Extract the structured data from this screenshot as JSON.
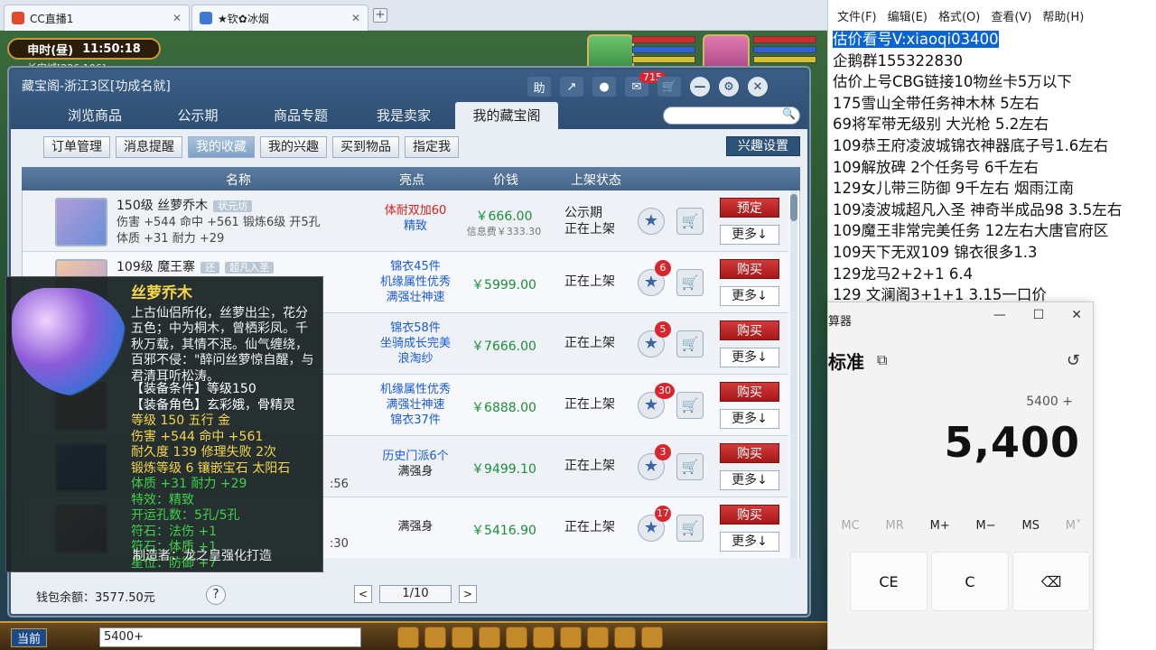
{
  "browser": {
    "tabs": [
      {
        "label": "CC直播1"
      },
      {
        "label": "★钦✿冰烟"
      }
    ],
    "new_tab": "+"
  },
  "game": {
    "time_label": "申时(昼)",
    "time_value": "11:50:18",
    "map": "长安城[226,106]",
    "chat_channel": "当前",
    "chat_input": "5400+"
  },
  "cbg": {
    "title": "藏宝阁-浙江3区[功成名就]",
    "ctrl": {
      "help": "助",
      "notif_count": "715"
    },
    "nav_tabs": [
      "浏览商品",
      "公示期",
      "商品专题",
      "我是卖家",
      "我的藏宝阁"
    ],
    "active_nav": 4,
    "sub_tabs": [
      "订单管理",
      "消息提醒",
      "我的收藏",
      "我的兴趣",
      "买到物品",
      "指定我"
    ],
    "active_sub": 2,
    "interest_button": "兴趣设置",
    "columns": {
      "name": "名称",
      "highlight": "亮点",
      "price": "价钱",
      "status": "上架状态"
    },
    "rows": [
      {
        "name": "150级  丝萝乔木",
        "tag": "状元坊",
        "line2": "伤害 +544 命中 +561 锻炼6级 开5孔",
        "line3": "体质 +31 耐力 +29",
        "hl": [
          "体耐双加60",
          "精致"
        ],
        "hl_red": true,
        "price": "￥666.00",
        "fee": "信息费￥333.30",
        "status1": "公示期",
        "status2": "正在上架",
        "badge": "",
        "buy": "预定",
        "more": "更多↓"
      },
      {
        "name": "109级  魔王寨",
        "tag": "还",
        "tag2": "超凡入圣",
        "line2": "",
        "line3": "",
        "hl": [
          "锦衣45件",
          "机缘属性优秀",
          "满强壮神速"
        ],
        "hl_red": false,
        "price": "￥5999.00",
        "fee": "",
        "status1": "正在上架",
        "status2": "",
        "badge": "6",
        "buy": "购买",
        "more": "更多↓"
      },
      {
        "name": "",
        "tag": "",
        "line2": "",
        "line3": "",
        "hl": [
          "锦衣58件",
          "坐骑成长完美",
          "浪淘纱"
        ],
        "hl_red": false,
        "price": "￥7666.00",
        "fee": "",
        "status1": "正在上架",
        "status2": "",
        "badge": "5",
        "buy": "购买",
        "more": "更多↓"
      },
      {
        "name": "",
        "tag": "",
        "line2": "",
        "line3": "",
        "hl": [
          "机缘属性优秀",
          "满强壮神速",
          "锦衣37件"
        ],
        "hl_red": false,
        "price": "￥6888.00",
        "fee": "",
        "status1": "正在上架",
        "status2": "",
        "badge": "30",
        "buy": "购买",
        "more": "更多↓"
      },
      {
        "name": "",
        "tag": "",
        "line2": "",
        "line3": ":56",
        "hl": [
          "历史门派6个",
          "满强身"
        ],
        "hl_red": false,
        "price": "￥9499.10",
        "fee": "",
        "status1": "正在上架",
        "status2": "",
        "badge": "3",
        "buy": "购买",
        "more": "更多↓"
      },
      {
        "name": "",
        "tag": "",
        "line2": "",
        "line3": ":30",
        "hl": [
          "满强身"
        ],
        "hl_red": false,
        "price": "￥5416.90",
        "fee": "",
        "status1": "正在上架",
        "status2": "",
        "badge": "17",
        "buy": "购买",
        "more": "更多↓"
      }
    ],
    "wallet": "钱包余额：3577.50元",
    "help": "?",
    "page": "1/10",
    "prev": "<",
    "next": ">"
  },
  "tooltip": {
    "title": "丝萝乔木",
    "desc": "上古仙侣所化，丝萝出尘，花分五色；中为桐木，曾栖彩凤。千秋万载，其情不泯。仙气缠绕，百邪不侵：\"醉问丝萝惊自醒，与君清耳听松涛。",
    "lines": [
      {
        "text": "【装备条件】等级150",
        "cls": "w"
      },
      {
        "text": "【装备角色】玄彩娥，骨精灵",
        "cls": "w"
      },
      {
        "text": "等级 150  五行 金",
        "cls": "y"
      },
      {
        "text": "伤害 +544 命中 +561",
        "cls": "y"
      },
      {
        "text": "耐久度 139  修理失败 2次",
        "cls": "y"
      },
      {
        "text": "锻炼等级 6  镶嵌宝石 太阳石",
        "cls": "y"
      },
      {
        "text": "体质 +31 耐力 +29",
        "cls": "g"
      },
      {
        "text": "特效：精致",
        "cls": "g"
      },
      {
        "text": "开运孔数：5孔/5孔",
        "cls": "g"
      },
      {
        "text": "符石：法伤 +1",
        "cls": "g"
      },
      {
        "text": "符石：体质 +1",
        "cls": "g"
      },
      {
        "text": "星位：防御 +7",
        "cls": "g"
      }
    ],
    "maker": "制造者：龙之皇强化打造"
  },
  "notepad": {
    "menu": [
      "文件(F)",
      "编辑(E)",
      "格式(O)",
      "查看(V)",
      "帮助(H)"
    ],
    "lines": [
      "估价看号V:xiaoqi03400",
      "企鹅群155322830",
      "估价上号CBG链接10物丝卡5万以下",
      "175雪山全带任务神木林 5左右",
      "69将军带无级别 大光枪 5.2左右",
      "109恭王府凌波城锦衣神器底子号1.6左右",
      "109解放碑 2个任务号 6千左右",
      "129女儿带三防御 9千左右 烟雨江南",
      "109凌波城超凡入圣 神奇半成品98 3.5左右",
      "109魔王非常完美任务 12左右大唐官府区",
      "109天下无双109  锦衣很多1.3",
      "129龙马2+2+1  6.4",
      "129 文澜阁3+1+1   3.15一口价"
    ]
  },
  "calculator": {
    "title": "算器",
    "mode": "标准",
    "expression": "5400 +",
    "result": "5,400",
    "memory": [
      "MC",
      "MR",
      "M+",
      "M−",
      "MS",
      "M˅"
    ],
    "keys": [
      "CE",
      "C",
      "⌫"
    ]
  }
}
